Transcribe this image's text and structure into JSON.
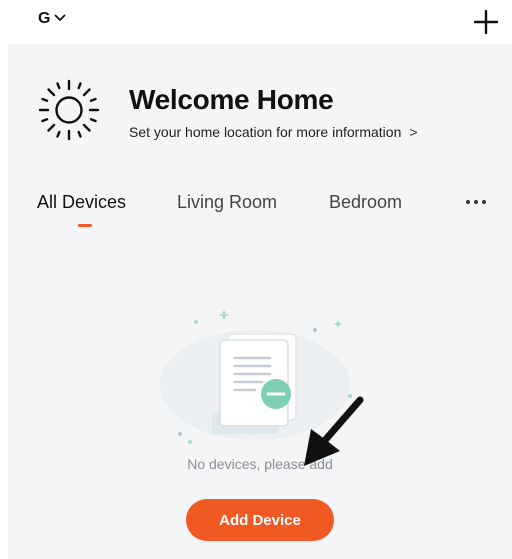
{
  "header": {
    "home_initial": "G",
    "home_dropdown_icon": "chevron-down-icon",
    "add_icon": "plus-icon"
  },
  "welcome": {
    "icon": "sun-icon",
    "title": "Welcome Home",
    "subtitle": "Set your home location for more information",
    "subtitle_arrow": ">"
  },
  "tabs": [
    {
      "label": "All Devices",
      "active": true
    },
    {
      "label": "Living Room",
      "active": false
    },
    {
      "label": "Bedroom",
      "active": false
    }
  ],
  "tabs_more_icon": "more-horizontal-icon",
  "empty_state": {
    "illustration": "no-devices-illustration",
    "message": "No devices, please add",
    "button_label": "Add Device"
  },
  "annotation_icon": "arrow-pointer-icon",
  "colors": {
    "accent": "#f05a22",
    "panel_background": "#f4f5f6",
    "illustration_mint": "#7fcfb2",
    "muted_text": "#8a8f95"
  }
}
